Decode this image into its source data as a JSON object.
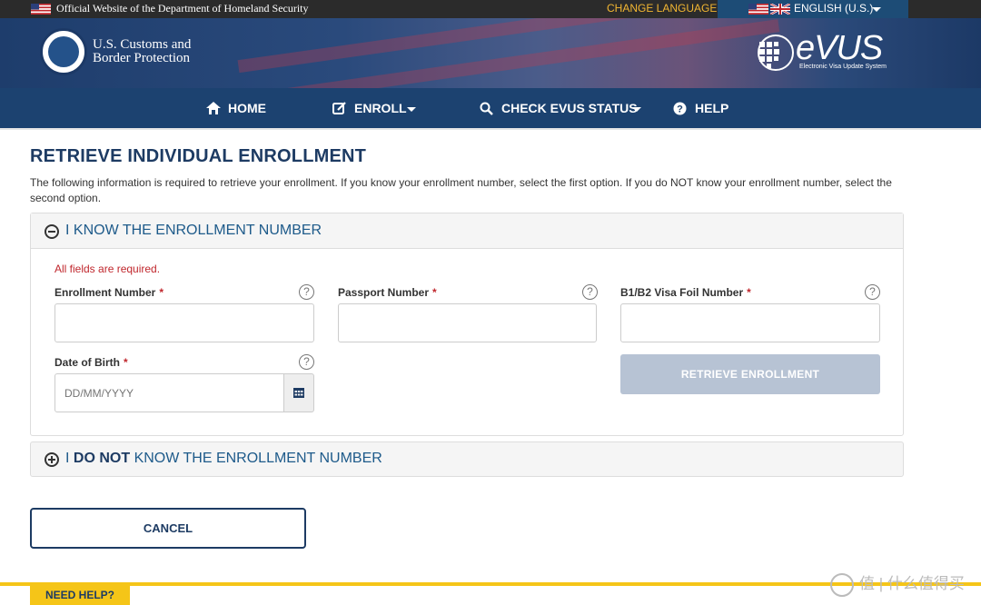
{
  "govbar": {
    "official_text": "Official Website of the Department of Homeland Security",
    "change_language": "CHANGE LANGUAGE",
    "language": "ENGLISH (U.S.)"
  },
  "header": {
    "agency_line1": "U.S. Customs and",
    "agency_line2": "Border Protection",
    "evus_logo": "eVUS",
    "evus_tagline": "Electronic Visa Update System"
  },
  "nav": {
    "items": [
      {
        "label": "HOME",
        "icon": "home-icon"
      },
      {
        "label": "ENROLL",
        "icon": "edit-icon"
      },
      {
        "label": "CHECK EVUS STATUS",
        "icon": "search-icon"
      },
      {
        "label": "HELP",
        "icon": "question-icon"
      }
    ]
  },
  "main": {
    "title": "RETRIEVE INDIVIDUAL ENROLLMENT",
    "intro": "The following information is required to retrieve your enrollment. If you know your enrollment number, select the first option. If you do NOT know your enrollment number, select the second option.",
    "panel_known": {
      "title": "I KNOW THE ENROLLMENT NUMBER",
      "required_note": "All fields are required.",
      "fields": {
        "enrollment_number": {
          "label": "Enrollment Number",
          "value": "",
          "required": "*"
        },
        "passport_number": {
          "label": "Passport Number",
          "value": "",
          "required": "*"
        },
        "visa_foil_number": {
          "label": "B1/B2 Visa Foil Number",
          "value": "",
          "required": "*"
        },
        "date_of_birth": {
          "label": "Date of Birth",
          "placeholder": "DD/MM/YYYY",
          "required": "*"
        }
      },
      "help_glyph": "?",
      "retrieve_button": "RETRIEVE ENROLLMENT"
    },
    "panel_unknown": {
      "title_prefix": "I",
      "title_bold": "DO NOT",
      "title_suffix": "KNOW THE ENROLLMENT NUMBER"
    },
    "cancel_button": "CANCEL"
  },
  "footer": {
    "need_help": "NEED HELP?"
  },
  "watermark": "值 | 什么值得买",
  "colors": {
    "nav_bg": "#1c4270",
    "title": "#1d3b63",
    "required": "#c0272d",
    "accent_yellow": "#f5c518",
    "disabled_button": "#b7c3d4"
  }
}
